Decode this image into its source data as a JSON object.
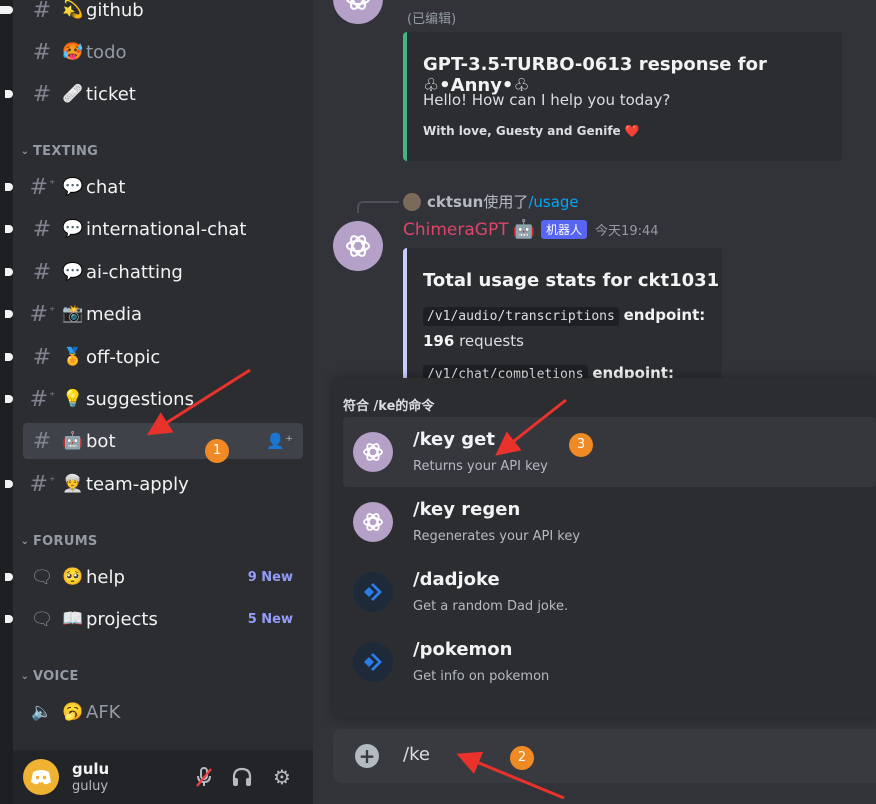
{
  "sidebar": {
    "channels_top": [
      {
        "emoji": "💫",
        "name": "github"
      },
      {
        "emoji": "🥵",
        "name": "todo"
      },
      {
        "emoji": "🩹",
        "name": "ticket"
      }
    ],
    "categories": {
      "texting": "TEXTING",
      "forums": "FORUMS",
      "voice": "VOICE"
    },
    "texting": [
      {
        "emoji": "💬",
        "name": "chat"
      },
      {
        "emoji": "💬",
        "name": "international-chat"
      },
      {
        "emoji": "💬",
        "name": "ai-chatting"
      },
      {
        "emoji": "📸",
        "name": "media"
      },
      {
        "emoji": "🏅",
        "name": "off-topic"
      },
      {
        "emoji": "💡",
        "name": "suggestions"
      },
      {
        "emoji": "🤖",
        "name": "bot"
      },
      {
        "emoji": "👳",
        "name": "team-apply"
      }
    ],
    "forums": [
      {
        "emoji": "🥺",
        "name": "help",
        "badge": "9 New"
      },
      {
        "emoji": "📖",
        "name": "projects",
        "badge": "5 New"
      }
    ],
    "voice": [
      {
        "emoji": "🥱",
        "name": "AFK"
      }
    ]
  },
  "user": {
    "display_name": "gulu",
    "username": "guluy"
  },
  "messages": {
    "edited_label": "(已编辑)",
    "embed1": {
      "title": "GPT-3.5-TURBO-0613 response for ♧•Anny•♧",
      "body": "Hello! How can I help you today?",
      "footer": "With love, Guesty and Genife ❤️"
    },
    "reply": {
      "user": "cktsun",
      "used": "使用了",
      "command": "/usage"
    },
    "author": "ChimeraGPT",
    "author_emoji": "🤖",
    "bot_badge": "机器人",
    "timestamp": "今天19:44",
    "embed2": {
      "title": "Total usage stats for ckt1031",
      "endpoint1_code": "/v1/audio/transcriptions",
      "endpoint_word": "endpoint:",
      "count": "196",
      "requests_word": "requests",
      "endpoint2_code": "/v1/chat/completions"
    }
  },
  "popup": {
    "title": "符合 /ke的命令",
    "commands": [
      {
        "name": "/key get",
        "desc": "Returns your API key"
      },
      {
        "name": "/key regen",
        "desc": "Regenerates your API key"
      },
      {
        "name": "/dadjoke",
        "desc": "Get a random Dad joke."
      },
      {
        "name": "/pokemon",
        "desc": "Get info on pokemon"
      }
    ]
  },
  "input": {
    "value": "/ke"
  },
  "annotations": {
    "one": "1",
    "two": "2",
    "three": "3"
  },
  "colors": {
    "annotation": "#f08a24",
    "arrow": "#e8322b",
    "accent": "#5865f2",
    "embed1_border": "#43b581",
    "embed2_border": "#c9cdfb",
    "author": "#e0446b"
  }
}
